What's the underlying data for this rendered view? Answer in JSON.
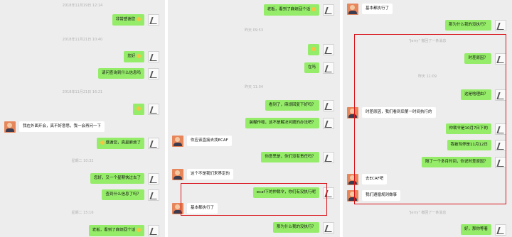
{
  "panel1": {
    "ts1": "2018年11月19日 12:14",
    "m1": "非常感谢您",
    "ts2": "2018年11月21日 10:40",
    "m2": "您好",
    "m3": "请问查询到什么信息吗",
    "ts3": "2018年11月21日 16:21",
    "m5": "我在外面开会，真不好意思，我一会再问一下",
    "m6": "感谢您，真是麻烦了",
    "ts4": "星期二 10:32",
    "m7": "您好，又一个星期快过去了",
    "m8": "查到什么信息了吗？",
    "ts5": "星期二 15:16",
    "m9": "老板，看到了麻烦回个话"
  },
  "panel2": {
    "m1": "老板，看到了麻烦回个话",
    "ts1": "昨天 09:53",
    "m3": "在吗",
    "ts2": "昨天 11:04",
    "m4": "看到了，麻烦回复下好吗？",
    "m5": "装糊作哑，这不是解决问题的办法吧？",
    "m6": "你应该直接去找ECAF",
    "m7": "你意思是，你们没有责任吗？",
    "m8": "这个不是我们来界定的",
    "m9": "ecaf下的仲裁令，你们有没执行呢",
    "m10": "基本都执行了",
    "m11": "那为什么我的没执行？"
  },
  "panel3": {
    "m1": "基本都执行了",
    "m2": "那为什么我的没执行？",
    "sys1": "\"Jerry\" 撤回了一条消息",
    "m3": "时差原因？",
    "ts1": "昨天 11:09",
    "m4": "这是啥理由？",
    "m5": "时差原因，我们看到后第一时间执行的",
    "m6": "仲裁令是10月7日下的",
    "m7": "我被骂停是11月12日",
    "m8": "隔了一个多月时间，你说时差原因？",
    "m9": "去ECAF吧",
    "m10": "我们遵循规则做事",
    "sys2": "\"Jerry\" 撤回了一条消息",
    "m11": "好，那你等着"
  },
  "colors": {
    "bg": "#ededed",
    "bubble_self": "#95ec69",
    "bubble_other": "#ffffff",
    "highlight": "#d9141b",
    "timestamp": "#b2b2b2"
  }
}
